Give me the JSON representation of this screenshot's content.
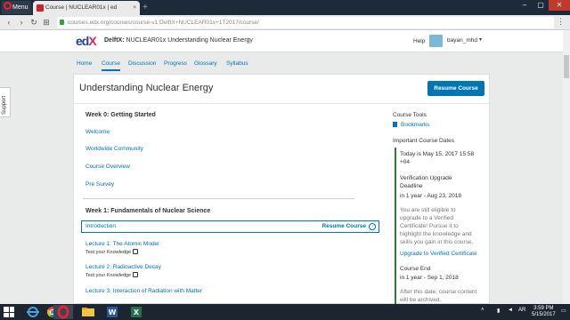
{
  "browser": {
    "menu_label": "Menu",
    "tab_title": "Course | NUCLEAR01x | ed",
    "tab_close": "×",
    "new_tab": "+",
    "url": "courses.edx.org/courses/course-v1:DelftX+NUCLEAR01x+1T2017/course/",
    "back": "‹",
    "forward": "›",
    "reload": "↻",
    "home": "⊞",
    "menu_dots": "⋮"
  },
  "header": {
    "logo_ed": "ed",
    "logo_x": "X",
    "course_org": "DelftX:",
    "course_name": "NUCLEAR01x Understanding Nuclear Energy",
    "help": "Help",
    "username": "bayan_mhd",
    "caret": "▾"
  },
  "course_nav": {
    "home": "Home",
    "course": "Course",
    "discussion": "Discussion",
    "progress": "Progress",
    "glossary": "Glossary",
    "syllabus": "Syllabus"
  },
  "support": {
    "label": "Support"
  },
  "main": {
    "title": "Understanding Nuclear Energy",
    "resume_button": "Resume Course",
    "week0": {
      "title": "Week 0: Getting Started",
      "items": [
        "Welcome",
        "Worldwide Community",
        "Course Overview",
        "Pre Survey"
      ]
    },
    "week1": {
      "title": "Week 1: Fundamentals of Nuclear Science",
      "intro": "Introduction",
      "resume": "Resume Course",
      "arrow": "›",
      "lectures": [
        {
          "title": "Lecture 1: The Atomic Model",
          "sub": "Test your Knowledge"
        },
        {
          "title": "Lecture 2: Radioactive Decay",
          "sub": "Test your Knowledge"
        },
        {
          "title": "Lecture 3: Interaction of Radiation with Matter",
          "sub": ""
        }
      ]
    }
  },
  "sidebar": {
    "tools_title": "Course Tools",
    "bookmarks": "Bookmarks",
    "dates_title": "Important Course Dates",
    "today_line1": "Today is May 15, 2017 15:58",
    "today_line2": "+04",
    "verification_title1": "Verification Upgrade",
    "verification_title2": "Deadline",
    "verification_date": "in 1 year - Aug 23, 2018",
    "eligible_lines": [
      "You are still eligible to",
      "upgrade to a Verified",
      "Certificate! Pursue it to",
      "highlight the knowledge and",
      "skills you gain in this course."
    ],
    "upgrade_link": "Upgrade to Verified Certificate",
    "course_end_title": "Course End",
    "course_end_date": "in 1 year - Sep 1, 2018",
    "after_lines": [
      "After this date, course content",
      "will be archived."
    ]
  },
  "taskbar": {
    "lang": "AR",
    "time": "3:59 PM",
    "date": "5/15/2017"
  },
  "colors": {
    "accent": "#0075b4",
    "edx_blue": "#23419f",
    "edx_pink": "#d22b5b",
    "dates_bar": "#2e7d32"
  }
}
